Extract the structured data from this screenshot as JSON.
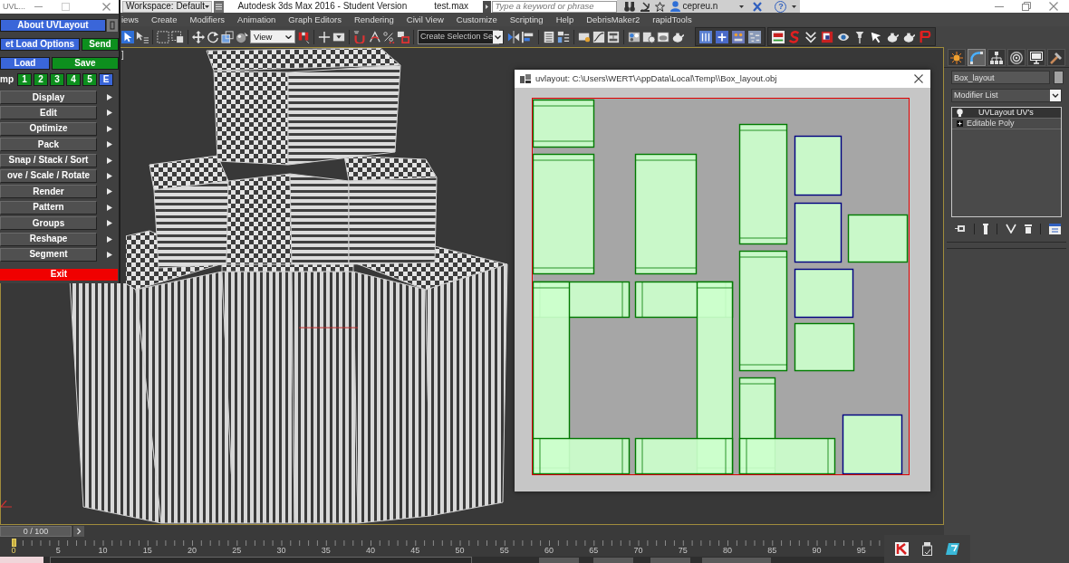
{
  "uvl_window": {
    "title": "UVL...",
    "button_rows": [
      [
        {
          "label": "About UVLayout",
          "color": "#3a66d9"
        }
      ],
      [
        {
          "label": "et Load Options",
          "color": "#3a66d9"
        },
        {
          "label": "Send",
          "color": "#0d8f1e"
        }
      ],
      [
        {
          "label": "Load",
          "color": "#3a66d9"
        },
        {
          "label": "Save",
          "color": "#0d8f1e"
        }
      ]
    ],
    "stamp_row": {
      "label": "mp",
      "buttons": [
        {
          "label": "1",
          "color": "#0d8f1e"
        },
        {
          "label": "2",
          "color": "#0d8f1e"
        },
        {
          "label": "3",
          "color": "#0d8f1e"
        },
        {
          "label": "4",
          "color": "#0d8f1e"
        },
        {
          "label": "5",
          "color": "#0d8f1e"
        },
        {
          "label": "E",
          "color": "#3a66d9"
        }
      ]
    },
    "menu_buttons": [
      "Display",
      "Edit",
      "Optimize",
      "Pack",
      "Snap / Stack / Sort",
      "ove / Scale / Rotate",
      "Render",
      "Pattern",
      "Groups",
      "Reshape",
      "Segment"
    ],
    "exit_button": "Exit"
  },
  "title_bar": {
    "workspace": "Workspace: Default",
    "title": "Autodesk 3ds Max 2016 - Student Version",
    "file_name": "test.max",
    "search": {
      "placeholder": "Type a keyword or phrase"
    },
    "user": "cepreu.n",
    "help_button": "?"
  },
  "menu_bar": [
    "iews",
    "Create",
    "Modifiers",
    "Animation",
    "Graph Editors",
    "Rendering",
    "Civil View",
    "Customize",
    "Scripting",
    "Help",
    "DebrisMaker2",
    "rapidTools"
  ],
  "toolbar": {
    "view_dropdown": "View",
    "selection_set": "Create Selection Se"
  },
  "viewport": {
    "label": "]"
  },
  "uv_window": {
    "title": "uvlayout: C:\\Users\\WERT\\AppData\\Local\\Temp\\\\Box_layout.obj"
  },
  "command_panel": {
    "tabs": [
      {
        "selected": false
      },
      {
        "selected": true
      },
      {
        "selected": false
      },
      {
        "selected": false
      },
      {
        "selected": false
      },
      {
        "selected": false
      }
    ],
    "object_name": "Box_layout",
    "modifier_list": "Modifier List",
    "modifier_stack": [
      {
        "label": "UVLayout UV's",
        "kind": "modifier",
        "selected": true
      },
      {
        "label": "Editable Poly",
        "kind": "base_object",
        "selected": false
      }
    ]
  },
  "timeline": {
    "time_slider": {
      "label": "0 / 100",
      "level": 0
    },
    "current_frame": "0",
    "ruler_labels": [
      "5",
      "10",
      "15",
      "20",
      "25",
      "30",
      "35",
      "40",
      "45",
      "50",
      "55",
      "60",
      "65",
      "70",
      "75",
      "80",
      "85",
      "90",
      "95"
    ]
  }
}
